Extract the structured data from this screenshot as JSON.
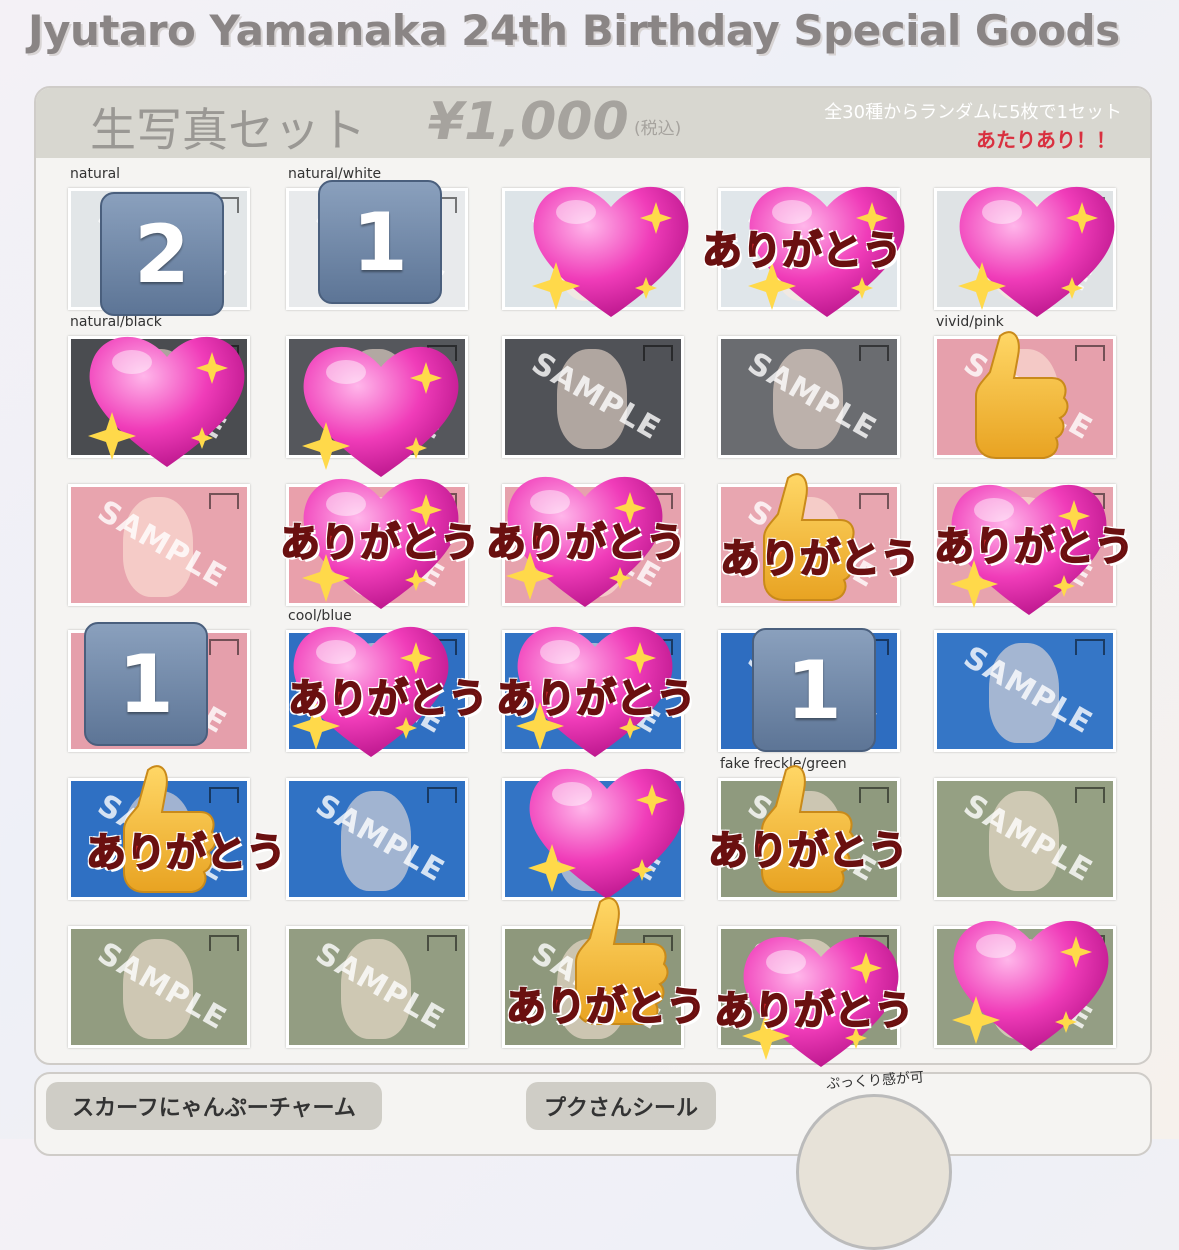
{
  "title": "Jyutaro Yamanaka 24th Birthday Special Goods",
  "set": {
    "name": "生写真セット",
    "price": "¥1,000",
    "tax": "(税込)",
    "note": "全30種からランダムに5枚で1セット",
    "hit": "あたりあり！！"
  },
  "watermark": "SAMPLE",
  "labels": {
    "natural": "natural",
    "natural_white": "natural/white",
    "natural_black": "natural/black",
    "vivid_pink": "vivid/pink",
    "cool_blue": "cool/blue",
    "fake_freckle_green": "fake freckle/green"
  },
  "stickers": {
    "thanks": "ありがとう",
    "n2": "2",
    "n1": "1"
  },
  "bottom": {
    "charm": "スカーフにゃんぷーチャーム",
    "seal": "プクさんシール",
    "puffy": "ぷっくり感が可"
  }
}
